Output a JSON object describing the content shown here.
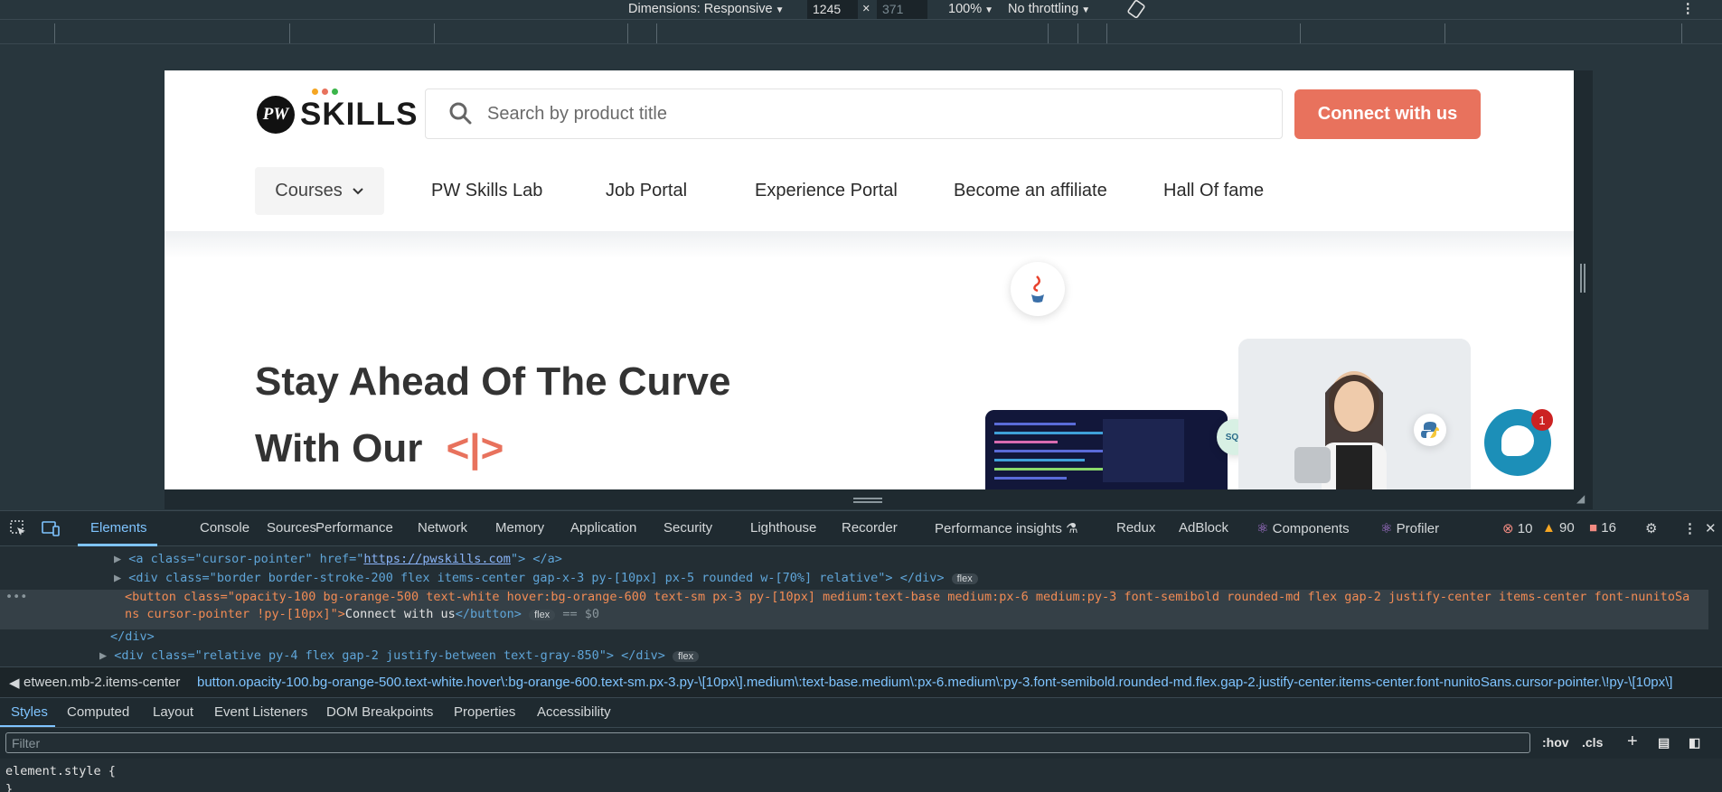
{
  "device_toolbar": {
    "dimensions_label": "Dimensions: Responsive",
    "width": "1245",
    "height": "371",
    "times": "×",
    "zoom": "100%",
    "throttling": "No throttling"
  },
  "site": {
    "logo_text": "SKILLS",
    "logo_mark": "PW",
    "search_placeholder": "Search by product title",
    "connect_label": "Connect with us",
    "nav": [
      "Courses",
      "PW Skills Lab",
      "Job Portal",
      "Experience Portal",
      "Become an affiliate",
      "Hall Of fame"
    ],
    "headline_line1": "Stay Ahead Of The Curve",
    "headline_line2": "With Our",
    "headline_glyph": "<|>",
    "chat_badge": "1",
    "sql_label": "SQL"
  },
  "devtools": {
    "tabs": [
      "Elements",
      "Console",
      "Sources",
      "Performance",
      "Network",
      "Memory",
      "Application",
      "Security",
      "Lighthouse",
      "Recorder",
      "Performance insights",
      "Redux",
      "AdBlock",
      "Components",
      "Profiler"
    ],
    "errors": "10",
    "warnings": "90",
    "issues": "16",
    "code_lines": {
      "l1_open": "<a class=\"cursor-pointer\" href=\"",
      "l1_href": "https://pwskills.com",
      "l1_close": "\"> </a>",
      "l2": "<div class=\"border border-stroke-200 flex items-center gap-x-3 py-[10px] px-5 rounded w-[70%] relative\"> </div>",
      "l3a": "<button class=\"opacity-100 bg-orange-500 text-white hover:bg-orange-600 text-sm px-3 py-[10px] medium:text-base medium:px-6 medium:py-3 font-semibold rounded-md flex gap-2 justify-center items-center font-nunitoSa",
      "l3b": "ns cursor-pointer !py-[10px]\">",
      "l3b_text": "Connect with us",
      "l3b_close": "</button>",
      "l3_eq": "== $0",
      "l4": "</div>",
      "l5": "<div class=\"relative py-4 flex gap-2 justify-between text-gray-850\"> </div>",
      "pill": "flex"
    },
    "breadcrumb_left": "etween.mb-2.items-center",
    "breadcrumb_selected": "button.opacity-100.bg-orange-500.text-white.hover\\:bg-orange-600.text-sm.px-3.py-\\[10px\\].medium\\:text-base.medium\\:px-6.medium\\:py-3.font-semibold.rounded-md.flex.gap-2.justify-center.items-center.font-nunitoSans.cursor-pointer.\\!py-\\[10px\\]",
    "subtabs": [
      "Styles",
      "Computed",
      "Layout",
      "Event Listeners",
      "DOM Breakpoints",
      "Properties",
      "Accessibility"
    ],
    "filter_placeholder": "Filter",
    "hov": ":hov",
    "cls": ".cls",
    "element_style": "element.style {",
    "element_style_close": "}"
  }
}
